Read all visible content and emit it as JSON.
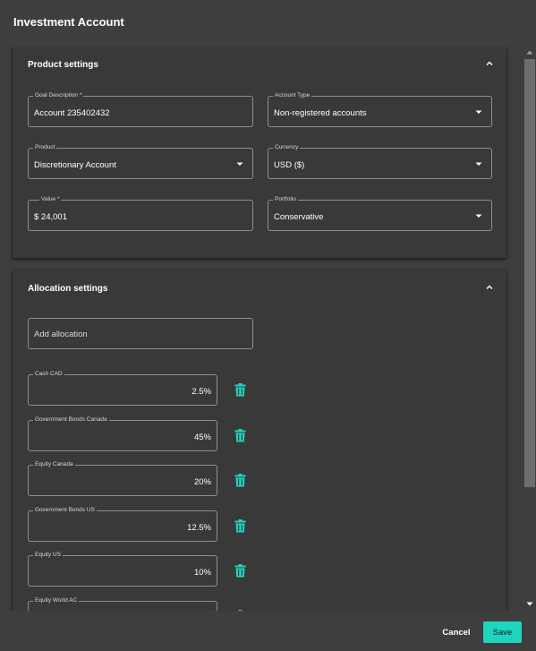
{
  "dialog": {
    "title": "Investment Account"
  },
  "product_settings": {
    "title": "Product settings",
    "fields": {
      "goal_description": {
        "label": "Goal Description *",
        "value": "Account 235402432"
      },
      "account_type": {
        "label": "Account Type",
        "value": "Non-registered accounts"
      },
      "product": {
        "label": "Product",
        "value": "Discretionary Account"
      },
      "currency": {
        "label": "Currency",
        "value": "USD ($)"
      },
      "value": {
        "label": "Value *",
        "value": "$ 24,001"
      },
      "portfolio": {
        "label": "Portfolio",
        "value": "Conservative"
      }
    }
  },
  "allocation_settings": {
    "title": "Allocation settings",
    "add_placeholder": "Add allocation",
    "items": [
      {
        "label": "Cash CAD",
        "value": "2.5%"
      },
      {
        "label": "Government Bonds Canada",
        "value": "45%"
      },
      {
        "label": "Equity Canada",
        "value": "20%"
      },
      {
        "label": "Government Bonds US",
        "value": "12.5%"
      },
      {
        "label": "Equity US",
        "value": "10%"
      },
      {
        "label": "Equity World AC",
        "value": ""
      }
    ]
  },
  "footer": {
    "cancel_label": "Cancel",
    "save_label": "Save"
  },
  "colors": {
    "accent": "#1ed6be",
    "background": "#3e3e3e",
    "panel": "#393939",
    "border": "#8e8e8e"
  },
  "icons": {
    "collapse": "chevron-up-icon",
    "dropdown": "caret-down-icon",
    "delete": "trash-icon"
  }
}
